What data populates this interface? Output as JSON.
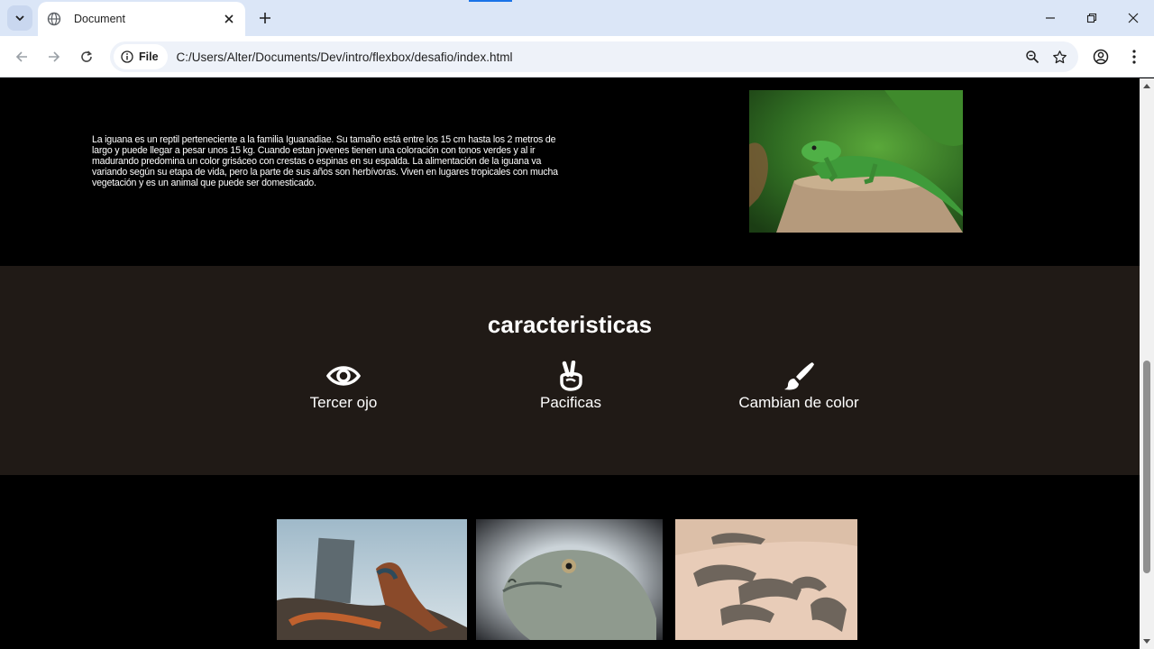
{
  "browser": {
    "tab_title": "Document",
    "url_chip": "File",
    "url": "C:/Users/Alter/Documents/Dev/intro/flexbox/desafio/index.html"
  },
  "intro": {
    "text": "La iguana es un reptil perteneciente a la familia Iguanadiae. Su tamaño está entre los 15 cm hasta los 2 metros de largo y puede llegar a pesar unos 15 kg. Cuando estan jovenes tienen una coloración con tonos verdes y al ir madurando predomina un color grisáceo con crestas o espinas en su espalda. La alimentación de la iguana va variando según su etapa de vida, pero la parte de sus años son herbívoras. Viven en lugares tropicales con mucha vegetación y es un animal que puede ser domesticado."
  },
  "features": {
    "title": "caracteristicas",
    "items": [
      {
        "label": "Tercer ojo",
        "icon": "eye-icon"
      },
      {
        "label": "Pacificas",
        "icon": "peace-hand-icon"
      },
      {
        "label": "Cambian de color",
        "icon": "paintbrush-icon"
      }
    ]
  },
  "colors": {
    "features_bg": "#201a16",
    "page_bg": "#000000",
    "tab_strip": "#dbe6f7"
  }
}
